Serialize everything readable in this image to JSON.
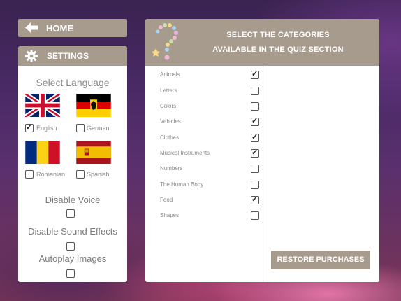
{
  "home": {
    "label": "HOME",
    "icon": "back-arrow-icon"
  },
  "settings": {
    "title": "SETTINGS",
    "icon": "gear-icon",
    "select_language": "Select Language",
    "languages": [
      {
        "label": "English",
        "checked": true,
        "flag": "uk-flag"
      },
      {
        "label": "German",
        "checked": false,
        "flag": "germany-flag"
      },
      {
        "label": "Romanian",
        "checked": false,
        "flag": "romania-flag"
      },
      {
        "label": "Spanish",
        "checked": false,
        "flag": "spain-flag"
      }
    ],
    "options": [
      {
        "label": "Disable Voice",
        "checked": false
      },
      {
        "label": "Disable Sound Effects",
        "checked": false
      },
      {
        "label": "Autoplay Images",
        "checked": false
      }
    ]
  },
  "categories_panel": {
    "title_line1": "SELECT THE CATEGORIES",
    "title_line2": "AVAILABLE IN THE QUIZ SECTION",
    "icon": "question-mark-icon",
    "categories": [
      {
        "label": "Animals",
        "checked": true
      },
      {
        "label": "Letters",
        "checked": false
      },
      {
        "label": "Colors",
        "checked": false
      },
      {
        "label": "Vehicles",
        "checked": true
      },
      {
        "label": "Clothes",
        "checked": true
      },
      {
        "label": "Musical Instruments",
        "checked": true
      },
      {
        "label": "Numbers",
        "checked": false
      },
      {
        "label": "The Human Body",
        "checked": false
      },
      {
        "label": "Food",
        "checked": true
      },
      {
        "label": "Shapes",
        "checked": false
      }
    ],
    "restore_label": "RESTORE PURCHASES"
  },
  "colors": {
    "bar": "#a69b8c",
    "panel": "#ffffff",
    "text_muted": "#8a8a8a"
  }
}
